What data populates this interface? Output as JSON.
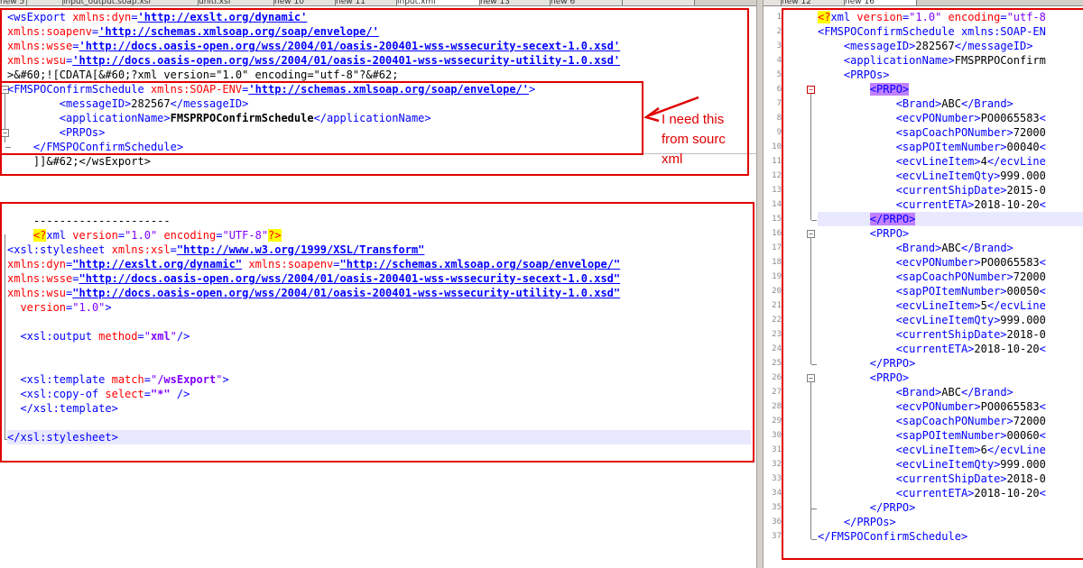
{
  "tabs_left": [
    "new 5",
    "input_output.soap.xsl",
    "uniti.xsl",
    "new 10",
    "new 11",
    "new 13",
    "input.xml",
    "new 6"
  ],
  "tabs_right": [
    "new 12",
    "new 16"
  ],
  "left_top_lines": [
    "<wsExport xmlns:dyn='http://exslt.org/dynamic'",
    "xmlns:soapenv='http://schemas.xmlsoap.org/soap/envelope/'",
    "xmlns:wsse='http://docs.oasis-open.org/wss/2004/01/oasis-200401-wss-wssecurity-secext-1.0.xsd'",
    "xmlns:wsu='http://docs.oasis-open.org/wss/2004/01/oasis-200401-wss-wssecurity-utility-1.0.xsd'",
    ">&#60;![CDATA[&#60;?xml version=\"1.0\" encoding=\"utf-8\"?&#62;",
    "<FMSPOConfirmSchedule xmlns:SOAP-ENV='http://schemas.xmlsoap.org/soap/envelope/'>",
    "        <messageID>282567</messageID>",
    "        <applicationName>FMSPRPOConfirmSchedule</applicationName>",
    "        <PRPOs>",
    "    </FMSPOConfirmSchedule>",
    "    ]]&#62;</wsExport>"
  ],
  "note_text": "I need this\nfrom sourc\nxml",
  "left_bottom_lines": [
    "    ---------------------",
    "    <?xml version=\"1.0\" encoding=\"UTF-8\"?>",
    "<xsl:stylesheet xmlns:xsl=\"http://www.w3.org/1999/XSL/Transform\"",
    "xmlns:dyn=\"http://exslt.org/dynamic\" xmlns:soapenv=\"http://schemas.xmlsoap.org/soap/envelope/\"",
    "xmlns:wsse=\"http://docs.oasis-open.org/wss/2004/01/oasis-200401-wss-wssecurity-secext-1.0.xsd\"",
    "xmlns:wsu=\"http://docs.oasis-open.org/wss/2004/01/oasis-200401-wss-wssecurity-utility-1.0.xsd\"",
    "  version=\"1.0\">",
    "",
    "  <xsl:output method=\"xml\"/>",
    "",
    "",
    "  <xsl:template match=\"/wsExport\">",
    "  <xsl:copy-of select=\"*\" />",
    "  </xsl:template>",
    "",
    "</xsl:stylesheet>"
  ],
  "right_line_numbers": [
    "1",
    "2",
    "3",
    "4",
    "5",
    "6",
    "7",
    "8",
    "9",
    "10",
    "11",
    "12",
    "13",
    "14",
    "15",
    "16",
    "17",
    "18",
    "19",
    "20",
    "21",
    "22",
    "23",
    "24",
    "25",
    "26",
    "27",
    "28",
    "29",
    "30",
    "31",
    "32",
    "33",
    "34",
    "35",
    "36",
    "37"
  ],
  "right_lines": [
    "<?xml version=\"1.0\" encoding=\"utf-8",
    "<FMSPOConfirmSchedule xmlns:SOAP-EN",
    "    <messageID>282567</messageID>",
    "    <applicationName>FMSPRPOConfirm",
    "    <PRPOs>",
    "        <PRPO>",
    "            <Brand>ABC</Brand>",
    "            <ecvPONumber>PO0065583<",
    "            <sapCoachPONumber>72000",
    "            <sapPOItemNumber>00040<",
    "            <ecvLineItem>4</ecvLine",
    "            <ecvLineItemQty>999.000",
    "            <currentShipDate>2015-0",
    "            <currentETA>2018-10-20<",
    "        </PRPO>",
    "        <PRPO>",
    "            <Brand>ABC</Brand>",
    "            <ecvPONumber>PO0065583<",
    "            <sapCoachPONumber>72000",
    "            <sapPOItemNumber>00050<",
    "            <ecvLineItem>5</ecvLine",
    "            <ecvLineItemQty>999.000",
    "            <currentShipDate>2018-0",
    "            <currentETA>2018-10-20<",
    "        </PRPO>",
    "        <PRPO>",
    "            <Brand>ABC</Brand>",
    "            <ecvPONumber>PO0065583<",
    "            <sapCoachPONumber>72000",
    "            <sapPOItemNumber>00060<",
    "            <ecvLineItem>6</ecvLine",
    "            <ecvLineItemQty>999.000",
    "            <currentShipDate>2018-0",
    "            <currentETA>2018-10-20<",
    "        </PRPO>",
    "    </PRPOs>",
    "</FMSPOConfirmSchedule>"
  ],
  "colors": {
    "annotation_red": "#e00000",
    "tag_blue": "#0000ff",
    "attr_red": "#ff0000",
    "value_purple": "#8000ff",
    "current_line": "#e8e8ff"
  }
}
